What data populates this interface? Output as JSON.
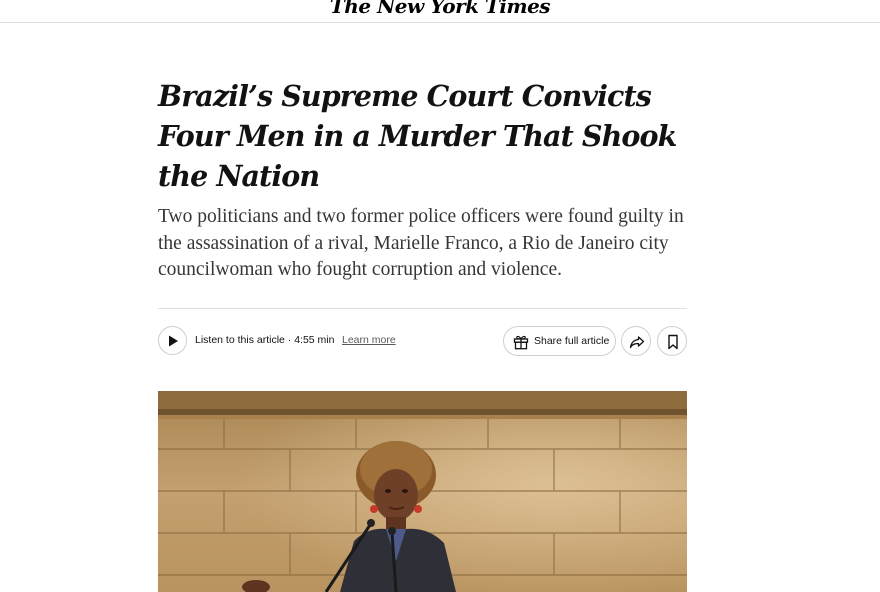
{
  "masthead": {
    "logo": "The New York Times"
  },
  "article": {
    "headline": "Brazil’s Supreme Court Convicts Four Men in a Murder That Shook the Nation",
    "summary": "Two politicians and two former police officers were found guilty in the assassination of a rival, Marielle Franco, a Rio de Janeiro city councilwoman who fought corruption and violence."
  },
  "toolbar": {
    "listen_label": "Listen to this article · 4:55 min",
    "learn_more": "Learn more",
    "share_label": "Share full article",
    "icons": [
      "play-icon",
      "gift-icon",
      "share-forward-icon",
      "bookmark-icon"
    ]
  },
  "photo": {
    "subject": "woman-speaking-at-microphone"
  }
}
